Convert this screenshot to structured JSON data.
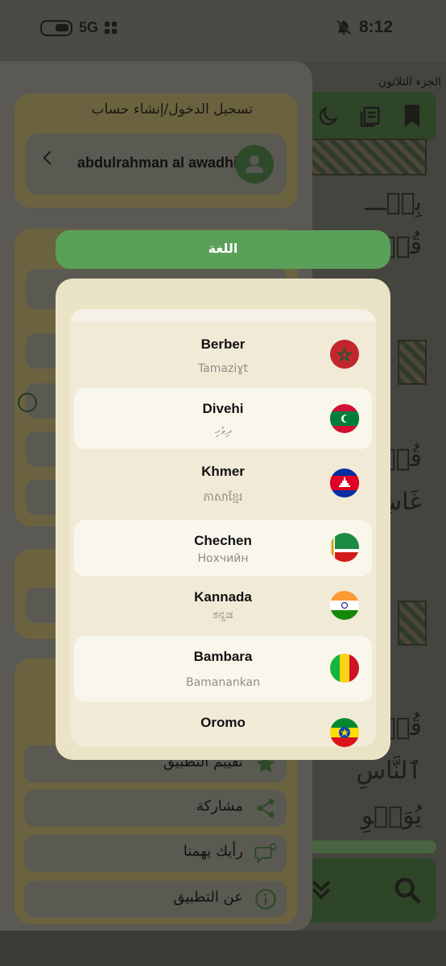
{
  "status_bar": {
    "network": "5G",
    "time": "8:12"
  },
  "background": {
    "juz_label": "الجزء الثلاثون"
  },
  "drawer": {
    "login_title": "تسجيل الدخول/إنشاء حساب",
    "user_name": "abdulrahman al awadhi",
    "menu": [
      {
        "label": "تقييم التطبيق",
        "icon": "star-icon"
      },
      {
        "label": "مشاركة",
        "icon": "share-icon"
      },
      {
        "label": "رأيك يهمنا",
        "icon": "feedback-icon"
      },
      {
        "label": "عن التطبيق",
        "icon": "info-icon"
      }
    ]
  },
  "language_dialog": {
    "title": "اللغة",
    "languages": [
      {
        "name": "Berber",
        "native": "Tamaziɣt",
        "flag": "morocco-flag-icon"
      },
      {
        "name": "Divehi",
        "native": "ދިވެހި",
        "flag": "maldives-flag-icon"
      },
      {
        "name": "Khmer",
        "native": "ភាសាខ្មែរ",
        "flag": "cambodia-flag-icon"
      },
      {
        "name": "Chechen",
        "native": "Нохчийн",
        "flag": "chechen-flag-icon"
      },
      {
        "name": "Kannada",
        "native": "ಕನ್ನಡ",
        "flag": "india-flag-icon"
      },
      {
        "name": "Bambara",
        "native": "Bamanankan",
        "flag": "mali-flag-icon"
      },
      {
        "name": "Oromo",
        "native": "",
        "flag": "ethiopia-flag-icon"
      }
    ]
  },
  "colors": {
    "accent_green": "#5aa058",
    "sheet_bg": "#ebe3c5",
    "list_bg": "#f0ead7",
    "item_highlight": "#f9f6ec"
  }
}
